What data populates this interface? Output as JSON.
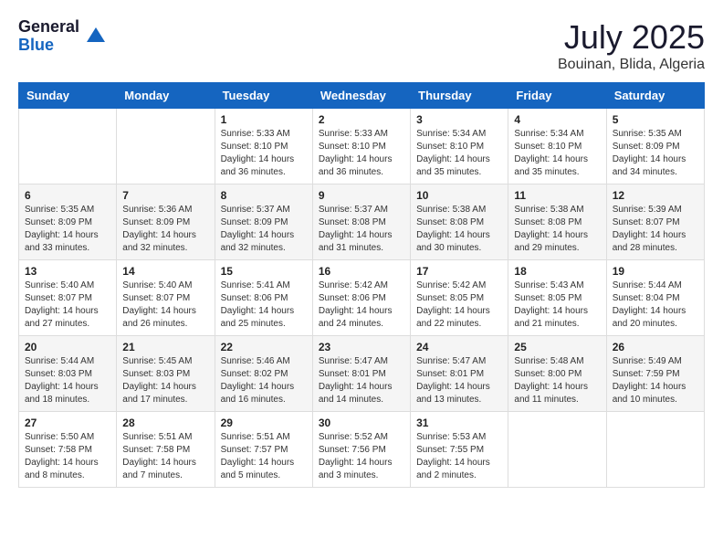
{
  "logo": {
    "general": "General",
    "blue": "Blue"
  },
  "title": {
    "month_year": "July 2025",
    "location": "Bouinan, Blida, Algeria"
  },
  "days_header": [
    "Sunday",
    "Monday",
    "Tuesday",
    "Wednesday",
    "Thursday",
    "Friday",
    "Saturday"
  ],
  "weeks": [
    [
      {
        "day": "",
        "sunrise": "",
        "sunset": "",
        "daylight": ""
      },
      {
        "day": "",
        "sunrise": "",
        "sunset": "",
        "daylight": ""
      },
      {
        "day": "1",
        "sunrise": "Sunrise: 5:33 AM",
        "sunset": "Sunset: 8:10 PM",
        "daylight": "Daylight: 14 hours and 36 minutes."
      },
      {
        "day": "2",
        "sunrise": "Sunrise: 5:33 AM",
        "sunset": "Sunset: 8:10 PM",
        "daylight": "Daylight: 14 hours and 36 minutes."
      },
      {
        "day": "3",
        "sunrise": "Sunrise: 5:34 AM",
        "sunset": "Sunset: 8:10 PM",
        "daylight": "Daylight: 14 hours and 35 minutes."
      },
      {
        "day": "4",
        "sunrise": "Sunrise: 5:34 AM",
        "sunset": "Sunset: 8:10 PM",
        "daylight": "Daylight: 14 hours and 35 minutes."
      },
      {
        "day": "5",
        "sunrise": "Sunrise: 5:35 AM",
        "sunset": "Sunset: 8:09 PM",
        "daylight": "Daylight: 14 hours and 34 minutes."
      }
    ],
    [
      {
        "day": "6",
        "sunrise": "Sunrise: 5:35 AM",
        "sunset": "Sunset: 8:09 PM",
        "daylight": "Daylight: 14 hours and 33 minutes."
      },
      {
        "day": "7",
        "sunrise": "Sunrise: 5:36 AM",
        "sunset": "Sunset: 8:09 PM",
        "daylight": "Daylight: 14 hours and 32 minutes."
      },
      {
        "day": "8",
        "sunrise": "Sunrise: 5:37 AM",
        "sunset": "Sunset: 8:09 PM",
        "daylight": "Daylight: 14 hours and 32 minutes."
      },
      {
        "day": "9",
        "sunrise": "Sunrise: 5:37 AM",
        "sunset": "Sunset: 8:08 PM",
        "daylight": "Daylight: 14 hours and 31 minutes."
      },
      {
        "day": "10",
        "sunrise": "Sunrise: 5:38 AM",
        "sunset": "Sunset: 8:08 PM",
        "daylight": "Daylight: 14 hours and 30 minutes."
      },
      {
        "day": "11",
        "sunrise": "Sunrise: 5:38 AM",
        "sunset": "Sunset: 8:08 PM",
        "daylight": "Daylight: 14 hours and 29 minutes."
      },
      {
        "day": "12",
        "sunrise": "Sunrise: 5:39 AM",
        "sunset": "Sunset: 8:07 PM",
        "daylight": "Daylight: 14 hours and 28 minutes."
      }
    ],
    [
      {
        "day": "13",
        "sunrise": "Sunrise: 5:40 AM",
        "sunset": "Sunset: 8:07 PM",
        "daylight": "Daylight: 14 hours and 27 minutes."
      },
      {
        "day": "14",
        "sunrise": "Sunrise: 5:40 AM",
        "sunset": "Sunset: 8:07 PM",
        "daylight": "Daylight: 14 hours and 26 minutes."
      },
      {
        "day": "15",
        "sunrise": "Sunrise: 5:41 AM",
        "sunset": "Sunset: 8:06 PM",
        "daylight": "Daylight: 14 hours and 25 minutes."
      },
      {
        "day": "16",
        "sunrise": "Sunrise: 5:42 AM",
        "sunset": "Sunset: 8:06 PM",
        "daylight": "Daylight: 14 hours and 24 minutes."
      },
      {
        "day": "17",
        "sunrise": "Sunrise: 5:42 AM",
        "sunset": "Sunset: 8:05 PM",
        "daylight": "Daylight: 14 hours and 22 minutes."
      },
      {
        "day": "18",
        "sunrise": "Sunrise: 5:43 AM",
        "sunset": "Sunset: 8:05 PM",
        "daylight": "Daylight: 14 hours and 21 minutes."
      },
      {
        "day": "19",
        "sunrise": "Sunrise: 5:44 AM",
        "sunset": "Sunset: 8:04 PM",
        "daylight": "Daylight: 14 hours and 20 minutes."
      }
    ],
    [
      {
        "day": "20",
        "sunrise": "Sunrise: 5:44 AM",
        "sunset": "Sunset: 8:03 PM",
        "daylight": "Daylight: 14 hours and 18 minutes."
      },
      {
        "day": "21",
        "sunrise": "Sunrise: 5:45 AM",
        "sunset": "Sunset: 8:03 PM",
        "daylight": "Daylight: 14 hours and 17 minutes."
      },
      {
        "day": "22",
        "sunrise": "Sunrise: 5:46 AM",
        "sunset": "Sunset: 8:02 PM",
        "daylight": "Daylight: 14 hours and 16 minutes."
      },
      {
        "day": "23",
        "sunrise": "Sunrise: 5:47 AM",
        "sunset": "Sunset: 8:01 PM",
        "daylight": "Daylight: 14 hours and 14 minutes."
      },
      {
        "day": "24",
        "sunrise": "Sunrise: 5:47 AM",
        "sunset": "Sunset: 8:01 PM",
        "daylight": "Daylight: 14 hours and 13 minutes."
      },
      {
        "day": "25",
        "sunrise": "Sunrise: 5:48 AM",
        "sunset": "Sunset: 8:00 PM",
        "daylight": "Daylight: 14 hours and 11 minutes."
      },
      {
        "day": "26",
        "sunrise": "Sunrise: 5:49 AM",
        "sunset": "Sunset: 7:59 PM",
        "daylight": "Daylight: 14 hours and 10 minutes."
      }
    ],
    [
      {
        "day": "27",
        "sunrise": "Sunrise: 5:50 AM",
        "sunset": "Sunset: 7:58 PM",
        "daylight": "Daylight: 14 hours and 8 minutes."
      },
      {
        "day": "28",
        "sunrise": "Sunrise: 5:51 AM",
        "sunset": "Sunset: 7:58 PM",
        "daylight": "Daylight: 14 hours and 7 minutes."
      },
      {
        "day": "29",
        "sunrise": "Sunrise: 5:51 AM",
        "sunset": "Sunset: 7:57 PM",
        "daylight": "Daylight: 14 hours and 5 minutes."
      },
      {
        "day": "30",
        "sunrise": "Sunrise: 5:52 AM",
        "sunset": "Sunset: 7:56 PM",
        "daylight": "Daylight: 14 hours and 3 minutes."
      },
      {
        "day": "31",
        "sunrise": "Sunrise: 5:53 AM",
        "sunset": "Sunset: 7:55 PM",
        "daylight": "Daylight: 14 hours and 2 minutes."
      },
      {
        "day": "",
        "sunrise": "",
        "sunset": "",
        "daylight": ""
      },
      {
        "day": "",
        "sunrise": "",
        "sunset": "",
        "daylight": ""
      }
    ]
  ]
}
